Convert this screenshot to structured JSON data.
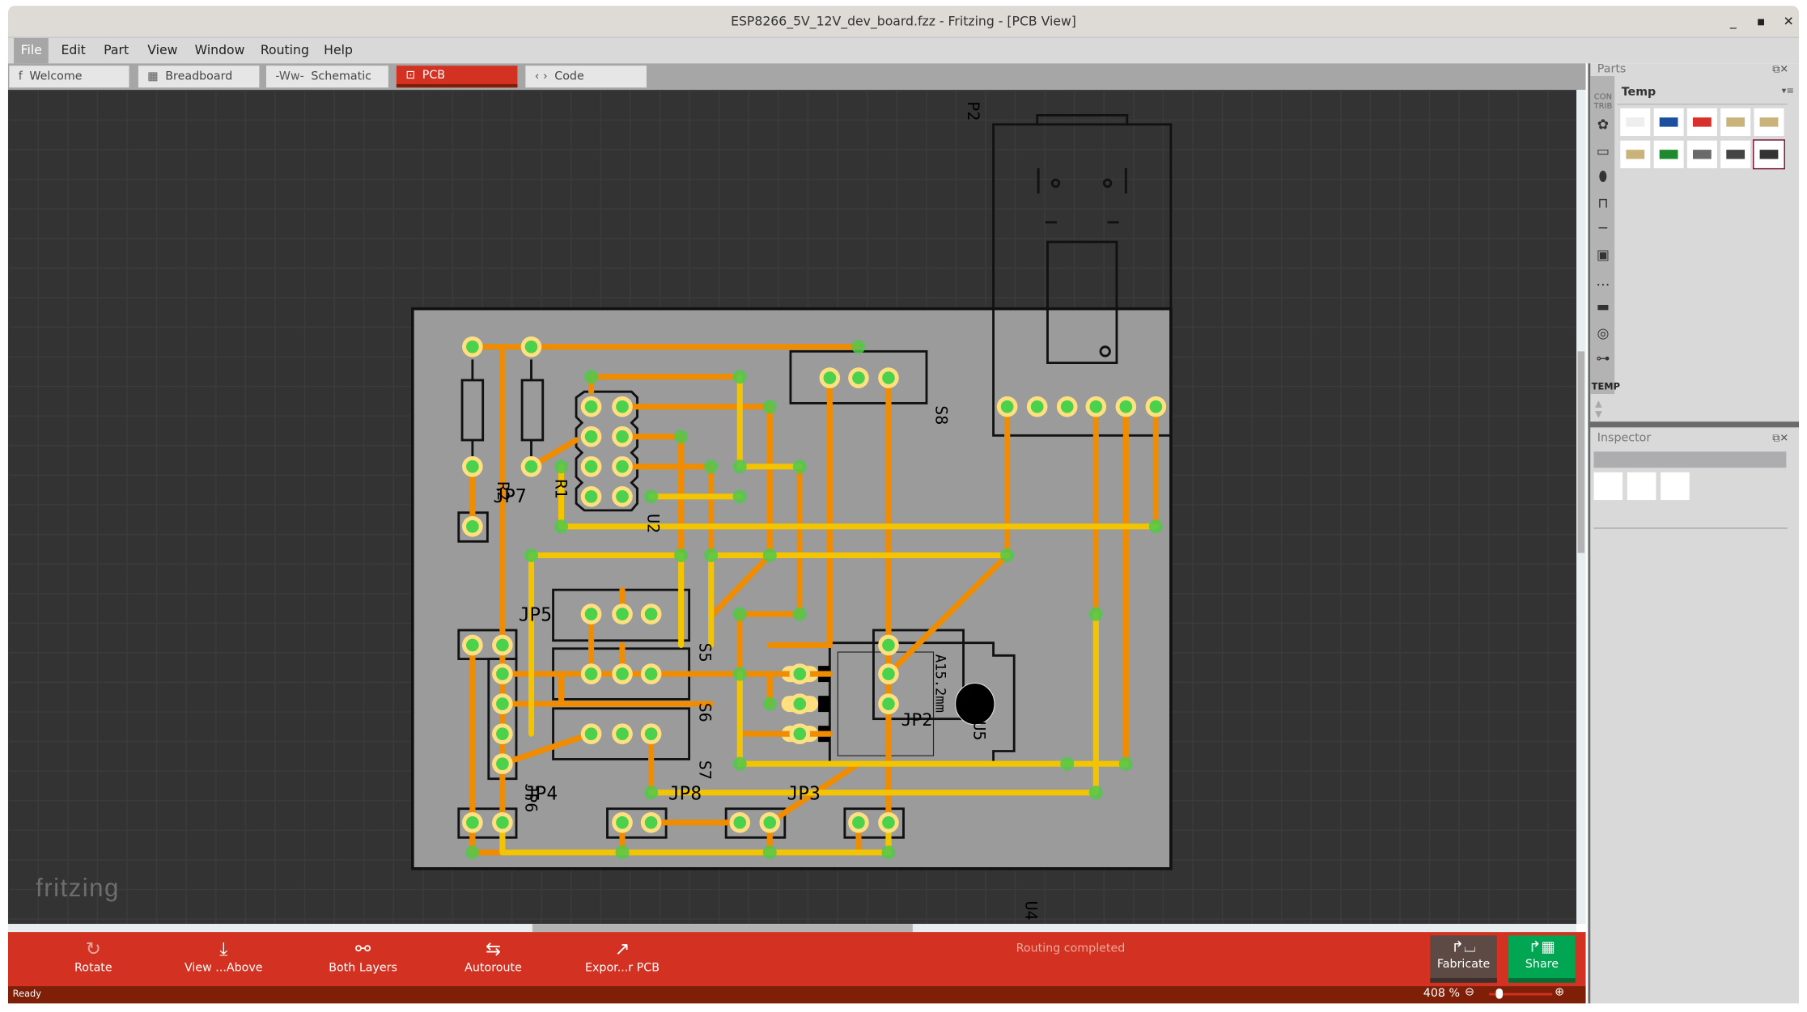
{
  "window": {
    "title": "ESP8266_5V_12V_dev_board.fzz - Fritzing - [PCB View]",
    "minimize": "_",
    "maximize": "▪",
    "close": "✕"
  },
  "menu": [
    "File",
    "Edit",
    "Part",
    "View",
    "Window",
    "Routing",
    "Help"
  ],
  "tabs": [
    {
      "label": "Welcome",
      "icon": "f"
    },
    {
      "label": "Breadboard",
      "icon": "▦"
    },
    {
      "label": "Schematic",
      "icon": "-Ww-"
    },
    {
      "label": "PCB",
      "icon": "⊡"
    },
    {
      "label": "Code",
      "icon": "‹ ›"
    }
  ],
  "pcb_labels": {
    "p2": "P2",
    "u4": "U4",
    "r2": "R2",
    "jp7": "JP7",
    "r1": "R1",
    "u2": "U2",
    "s8": "S8",
    "jp5": "JP5",
    "s5": "S5",
    "s6": "S6",
    "s7": "S7",
    "jp4": "JP4",
    "jp6": "JP6",
    "jp8": "JP8",
    "jp3": "JP3",
    "jp2": "JP2",
    "u5": "U5",
    "a15": "A15.2mm"
  },
  "colors": {
    "bottom_trace": "#f08c00",
    "top_trace": "#f2c500",
    "board": "#9b9b9b",
    "accent": "#d33222"
  },
  "watermark": "fritzing",
  "toolbar": {
    "buttons": [
      {
        "label": "Rotate",
        "icon": "↻"
      },
      {
        "label": "View ...Above",
        "icon": "⤓"
      },
      {
        "label": "Both Layers",
        "icon": "⚯"
      },
      {
        "label": "Autoroute",
        "icon": "⇆"
      },
      {
        "label": "Expor...r PCB",
        "icon": "↗"
      }
    ],
    "routing_status": "Routing completed",
    "fabricate": "Fabricate",
    "share": "Share"
  },
  "status": {
    "text": "Ready",
    "zoom": "408 %",
    "zoom_slider_fraction": 0.1
  },
  "parts": {
    "title": "Parts",
    "bin_title": "Temp",
    "contrib": "CON TRIB",
    "temp_tab": "TEMP",
    "bins": [
      "core-bin",
      "ic-bin",
      "arduino-bin",
      "logic-bin",
      "diode-bin",
      "button-bin",
      "more-bin",
      "chip-bin",
      "antenna-bin",
      "sensor-bin"
    ],
    "items": [
      "breadboard",
      "esp8266-module",
      "ftdi-board",
      "pin-header-1",
      "pin-header-2",
      "pin-header-4",
      "voltage-regulator-board",
      "resistor",
      "slide-switch",
      "regulator-to220"
    ]
  },
  "inspector": {
    "title": "Inspector"
  }
}
